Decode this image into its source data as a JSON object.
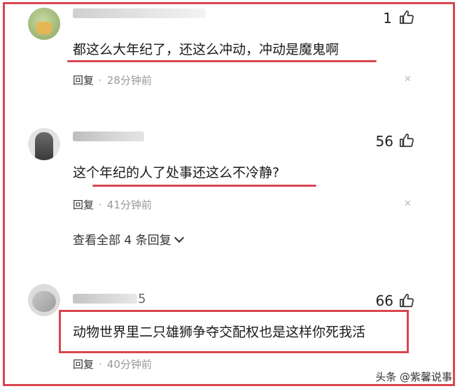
{
  "comments": [
    {
      "name_partial": "",
      "likes": "1",
      "text": "都这么大年纪了，还这么冲动，冲动是魔鬼啊",
      "reply_label": "回复",
      "time": "28分钟前"
    },
    {
      "name_partial": "",
      "likes": "56",
      "text": "这个年纪的人了处事还这么不冷静?",
      "reply_label": "回复",
      "time": "41分钟前",
      "view_all": "查看全部 4 条回复"
    },
    {
      "name_partial": "5",
      "likes": "66",
      "text": "动物世界里二只雄狮争夺交配权也是这样你死我活",
      "reply_label": "回复",
      "time": "40分钟前"
    }
  ],
  "watermark": "头条 @紫馨说事",
  "colors": {
    "accent": "#d9464f",
    "meta": "#999999"
  },
  "icons": {
    "like": "thumbs-up-icon",
    "close": "close-icon",
    "expand": "chevron-down-icon"
  }
}
